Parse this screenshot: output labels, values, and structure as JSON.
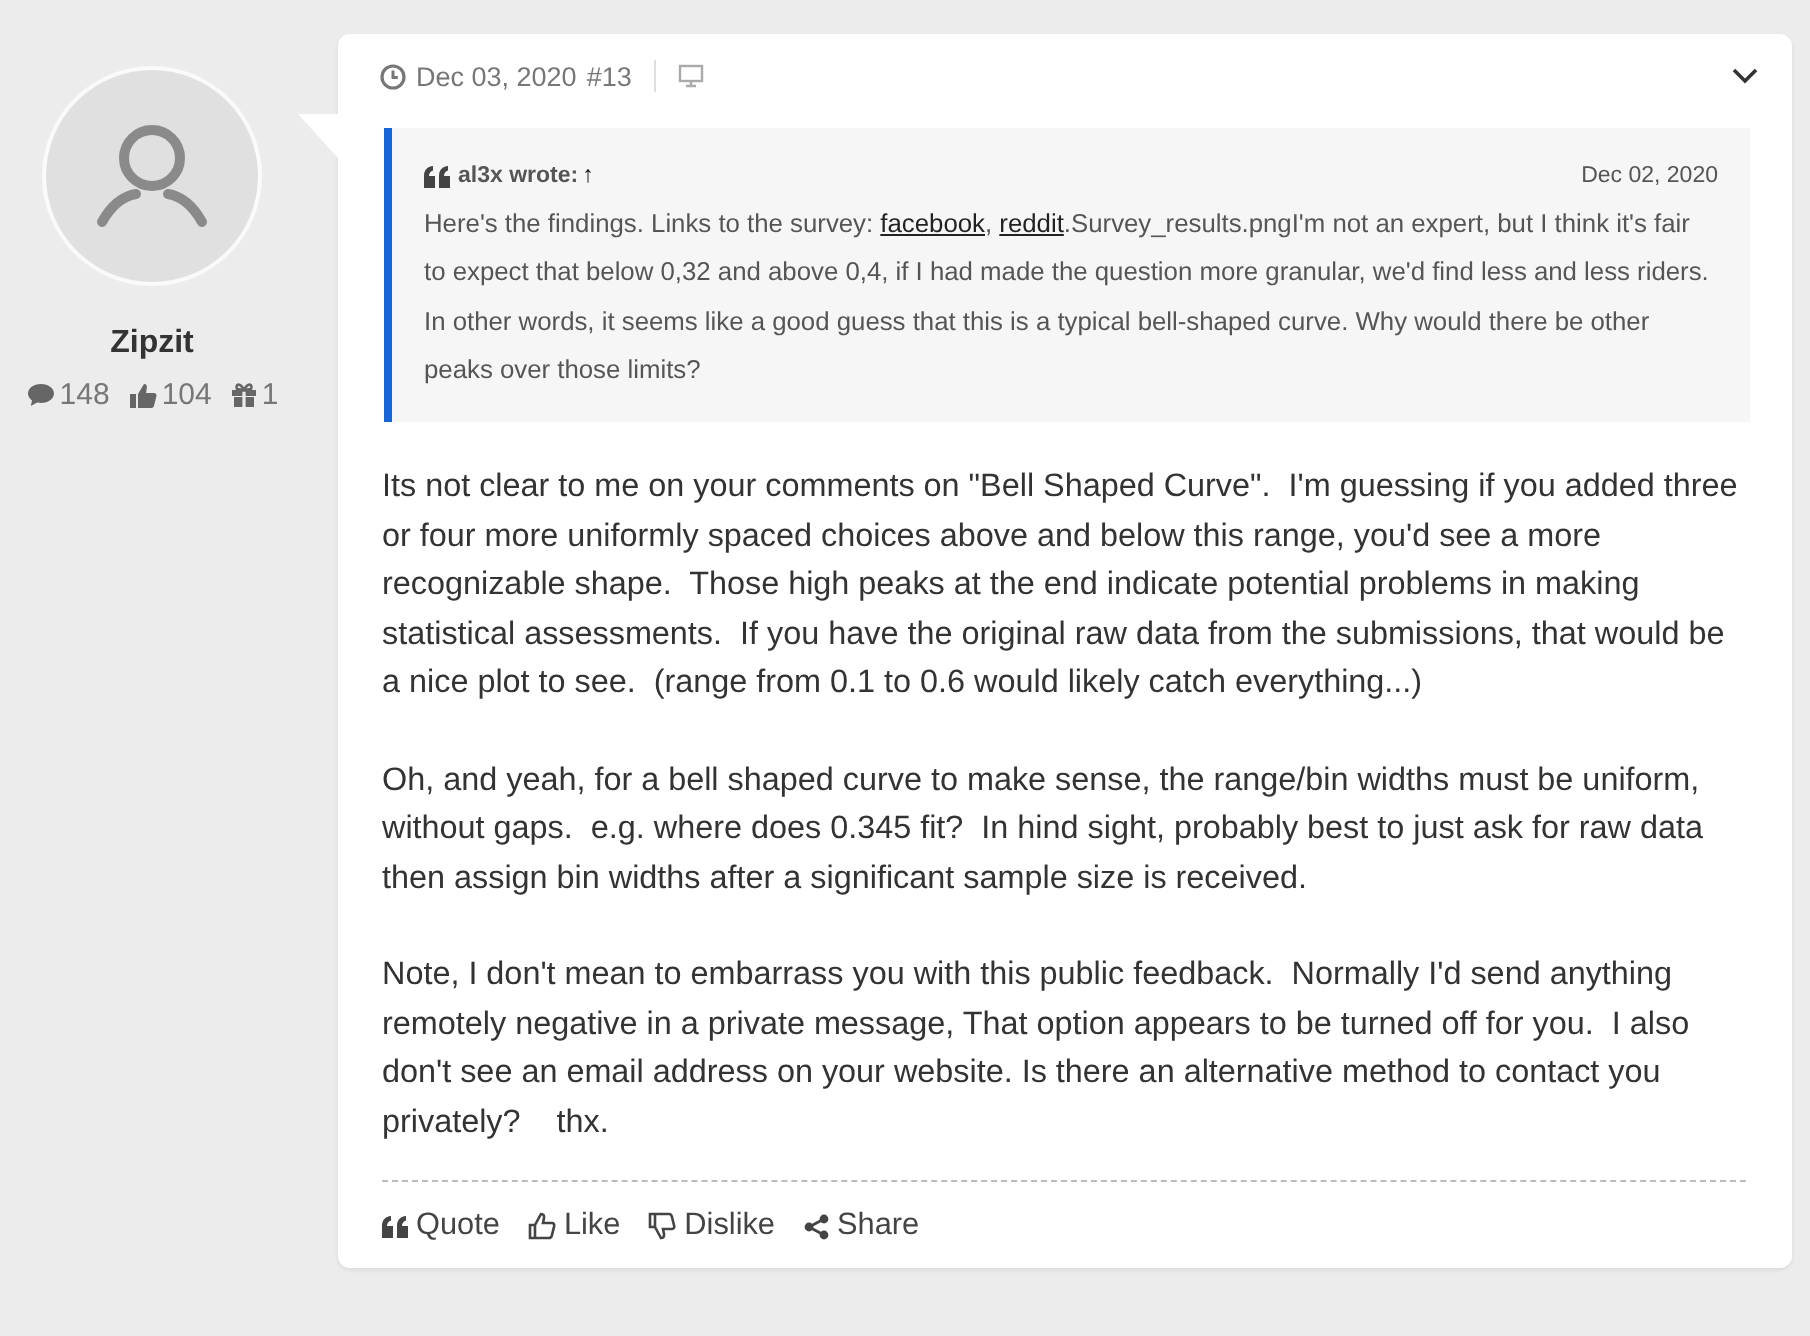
{
  "author": {
    "name": "Zipzit",
    "stats": [
      {
        "kind": "comments",
        "value": "148"
      },
      {
        "kind": "likes",
        "value": "104"
      },
      {
        "kind": "gifts",
        "value": "1"
      }
    ]
  },
  "post": {
    "date": "Dec 03, 2020",
    "number": "#13",
    "quote": {
      "author": "al3x wrote:",
      "arrow": "↑",
      "date": "Dec 02, 2020",
      "body": [
        {
          "kind": "text",
          "text": "Here's the findings. Links to the survey: "
        },
        {
          "kind": "link",
          "text": "facebook"
        },
        {
          "kind": "text",
          "text": ", "
        },
        {
          "kind": "link",
          "text": "reddit"
        },
        {
          "kind": "text",
          "text": ".Survey_results.pngI'm not an expert, but I think it's fair to expect that below 0,32 and above 0,4, if I had made the question more granular, we'd find less and less riders. In other words, it seems like a good guess that this is a typical bell-shaped curve. Why would there be other peaks over those limits?"
        }
      ]
    },
    "paragraphs": [
      "Its not clear to me on your comments on \"Bell Shaped Curve\".  I'm guessing if you added three or four more uniformly spaced choices above and below this range, you'd see a more recognizable shape.  Those high peaks at the end indicate potential problems in making statistical assessments.  If you have the original raw data from the submissions, that would be a nice plot to see.  (range from 0.1 to 0.6 would likely catch everything...)",
      "Oh, and yeah, for a bell shaped curve to make sense, the range/bin widths must be uniform, without gaps.  e.g. where does 0.345 fit?  In hind sight, probably best to just ask for raw data then assign bin widths after a significant sample size is received.",
      "Note, I don't mean to embarrass you with this public feedback.  Normally I'd send anything remotely negative in a private message, That option appears to be turned off for you.  I also don't see an email address on your website. Is there an alternative method to contact you privately?    thx."
    ],
    "actions": [
      {
        "kind": "quote",
        "label": "Quote"
      },
      {
        "kind": "like",
        "label": "Like"
      },
      {
        "kind": "dislike",
        "label": "Dislike"
      },
      {
        "kind": "share",
        "label": "Share"
      }
    ]
  }
}
